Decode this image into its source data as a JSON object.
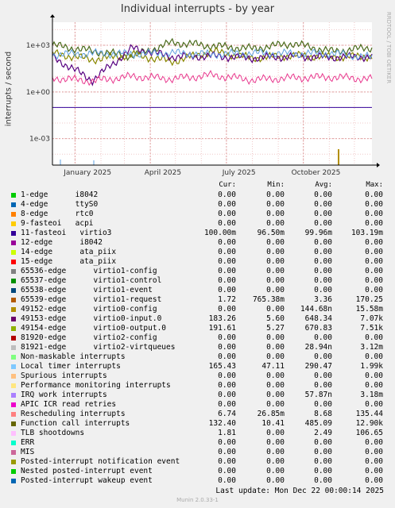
{
  "chart_data": {
    "type": "line",
    "title": "Individual interrupts - by year",
    "ylabel": "interrupts / second",
    "yscale": "log",
    "ylim": [
      2e-05,
      30000
    ],
    "yticks": [
      "1e+03",
      "1e+00",
      "1e-03"
    ],
    "xlim": [
      "2024-12-05",
      "2025-12-22"
    ],
    "xticks": [
      "January 2025",
      "April 2025",
      "July 2025",
      "October 2025"
    ],
    "grid": true,
    "legend_position": "bottom",
    "series": [
      {
        "name": "Function call interrupts",
        "color": "#4a6a1a",
        "values_approx": [
          1000,
          420,
          200,
          1500,
          900,
          600,
          1300,
          400,
          700
        ]
      },
      {
        "name": "virtio0-output.0",
        "color": "#888800",
        "values_approx": [
          300,
          120,
          250,
          90,
          400,
          150,
          220,
          180,
          190
        ]
      },
      {
        "name": "virtio0-input.0",
        "color": "#560080",
        "values_approx": [
          180,
          5.6,
          648,
          180,
          200,
          150,
          190,
          170,
          183
        ]
      },
      {
        "name": "Rescheduling interrupts",
        "color": "#e8388e",
        "values_approx": [
          8,
          5,
          10,
          7,
          12,
          6,
          8,
          9,
          6.7
        ]
      },
      {
        "name": "Local timer interrupts",
        "color": "#5ea0e0",
        "values_approx": [
          250,
          300,
          280,
          320,
          260,
          310,
          290,
          300,
          165
        ]
      },
      {
        "name": "virtio3",
        "color": "#330099",
        "values_approx": [
          0.1,
          0.1,
          0.1,
          0.1,
          0.1,
          0.1,
          0.1,
          0.1,
          0.1
        ]
      }
    ],
    "columns": [
      "Cur:",
      "Min:",
      "Avg:",
      "Max:"
    ],
    "legend": [
      {
        "color": "#00cc00",
        "name": "1-edge      i8042",
        "cur": "0.00",
        "min": "0.00",
        "avg": "0.00",
        "max": "0.00"
      },
      {
        "color": "#0066b3",
        "name": "4-edge      ttyS0",
        "cur": "0.00",
        "min": "0.00",
        "avg": "0.00",
        "max": "0.00"
      },
      {
        "color": "#ff8000",
        "name": "8-edge      rtc0",
        "cur": "0.00",
        "min": "0.00",
        "avg": "0.00",
        "max": "0.00"
      },
      {
        "color": "#ffcc00",
        "name": "9-fasteoi   acpi",
        "cur": "0.00",
        "min": "0.00",
        "avg": "0.00",
        "max": "0.00"
      },
      {
        "color": "#330099",
        "name": "11-fasteoi   virtio3",
        "cur": "100.00m",
        "min": "96.50m",
        "avg": "99.96m",
        "max": "103.19m"
      },
      {
        "color": "#990099",
        "name": "12-edge      i8042",
        "cur": "0.00",
        "min": "0.00",
        "avg": "0.00",
        "max": "0.00"
      },
      {
        "color": "#ccff00",
        "name": "14-edge      ata_piix",
        "cur": "0.00",
        "min": "0.00",
        "avg": "0.00",
        "max": "0.00"
      },
      {
        "color": "#ff0000",
        "name": "15-edge      ata_piix",
        "cur": "0.00",
        "min": "0.00",
        "avg": "0.00",
        "max": "0.00"
      },
      {
        "color": "#808080",
        "name": "65536-edge      virtio1-config",
        "cur": "0.00",
        "min": "0.00",
        "avg": "0.00",
        "max": "0.00"
      },
      {
        "color": "#008f00",
        "name": "65537-edge      virtio1-control",
        "cur": "0.00",
        "min": "0.00",
        "avg": "0.00",
        "max": "0.00"
      },
      {
        "color": "#00487d",
        "name": "65538-edge      virtio1-event",
        "cur": "0.00",
        "min": "0.00",
        "avg": "0.00",
        "max": "0.00"
      },
      {
        "color": "#b35a00",
        "name": "65539-edge      virtio1-request",
        "cur": "1.72",
        "min": "765.38m",
        "avg": "3.36",
        "max": "170.25"
      },
      {
        "color": "#b38f00",
        "name": "49152-edge      virtio0-config",
        "cur": "0.00",
        "min": "0.00",
        "avg": "144.68n",
        "max": "15.58m"
      },
      {
        "color": "#6b006b",
        "name": "49153-edge      virtio0-input.0",
        "cur": "183.26",
        "min": "5.60",
        "avg": "648.34",
        "max": "7.07k"
      },
      {
        "color": "#8fb300",
        "name": "49154-edge      virtio0-output.0",
        "cur": "191.61",
        "min": "5.27",
        "avg": "670.83",
        "max": "7.51k"
      },
      {
        "color": "#b30000",
        "name": "81920-edge      virtio2-config",
        "cur": "0.00",
        "min": "0.00",
        "avg": "0.00",
        "max": "0.00"
      },
      {
        "color": "#bebebe",
        "name": "81921-edge      virtio2-virtqueues",
        "cur": "0.00",
        "min": "0.00",
        "avg": "28.94n",
        "max": "3.12m"
      },
      {
        "color": "#80ff80",
        "name": "Non-maskable interrupts",
        "cur": "0.00",
        "min": "0.00",
        "avg": "0.00",
        "max": "0.00"
      },
      {
        "color": "#80c9ff",
        "name": "Local timer interrupts",
        "cur": "165.43",
        "min": "47.11",
        "avg": "290.47",
        "max": "1.99k"
      },
      {
        "color": "#ffc080",
        "name": "Spurious interrupts",
        "cur": "0.00",
        "min": "0.00",
        "avg": "0.00",
        "max": "0.00"
      },
      {
        "color": "#ffe680",
        "name": "Performance monitoring interrupts",
        "cur": "0.00",
        "min": "0.00",
        "avg": "0.00",
        "max": "0.00"
      },
      {
        "color": "#aa80ff",
        "name": "IRQ work interrupts",
        "cur": "0.00",
        "min": "0.00",
        "avg": "57.87n",
        "max": "3.18m"
      },
      {
        "color": "#ee00cc",
        "name": "APIC ICR read retries",
        "cur": "0.00",
        "min": "0.00",
        "avg": "0.00",
        "max": "0.00"
      },
      {
        "color": "#ff8080",
        "name": "Rescheduling interrupts",
        "cur": "6.74",
        "min": "26.85m",
        "avg": "8.68",
        "max": "135.44"
      },
      {
        "color": "#666600",
        "name": "Function call interrupts",
        "cur": "132.40",
        "min": "10.41",
        "avg": "485.09",
        "max": "12.90k"
      },
      {
        "color": "#ffbfff",
        "name": "TLB shootdowns",
        "cur": "1.81",
        "min": "0.00",
        "avg": "2.49",
        "max": "106.65"
      },
      {
        "color": "#00ffcc",
        "name": "ERR",
        "cur": "0.00",
        "min": "0.00",
        "avg": "0.00",
        "max": "0.00"
      },
      {
        "color": "#cc6699",
        "name": "MIS",
        "cur": "0.00",
        "min": "0.00",
        "avg": "0.00",
        "max": "0.00"
      },
      {
        "color": "#999900",
        "name": "Posted-interrupt notification event",
        "cur": "0.00",
        "min": "0.00",
        "avg": "0.00",
        "max": "0.00"
      },
      {
        "color": "#00cc00",
        "name": "Nested posted-interrupt event",
        "cur": "0.00",
        "min": "0.00",
        "avg": "0.00",
        "max": "0.00"
      },
      {
        "color": "#0066b3",
        "name": "Posted-interrupt wakeup event",
        "cur": "0.00",
        "min": "0.00",
        "avg": "0.00",
        "max": "0.00"
      }
    ]
  },
  "side_label": "RRDTOOL / TOBI OETIKER",
  "last_update": "Last update:  Mon Dec 22 00:00:14 2025",
  "munin_version": "Munin 2.0.33-1"
}
